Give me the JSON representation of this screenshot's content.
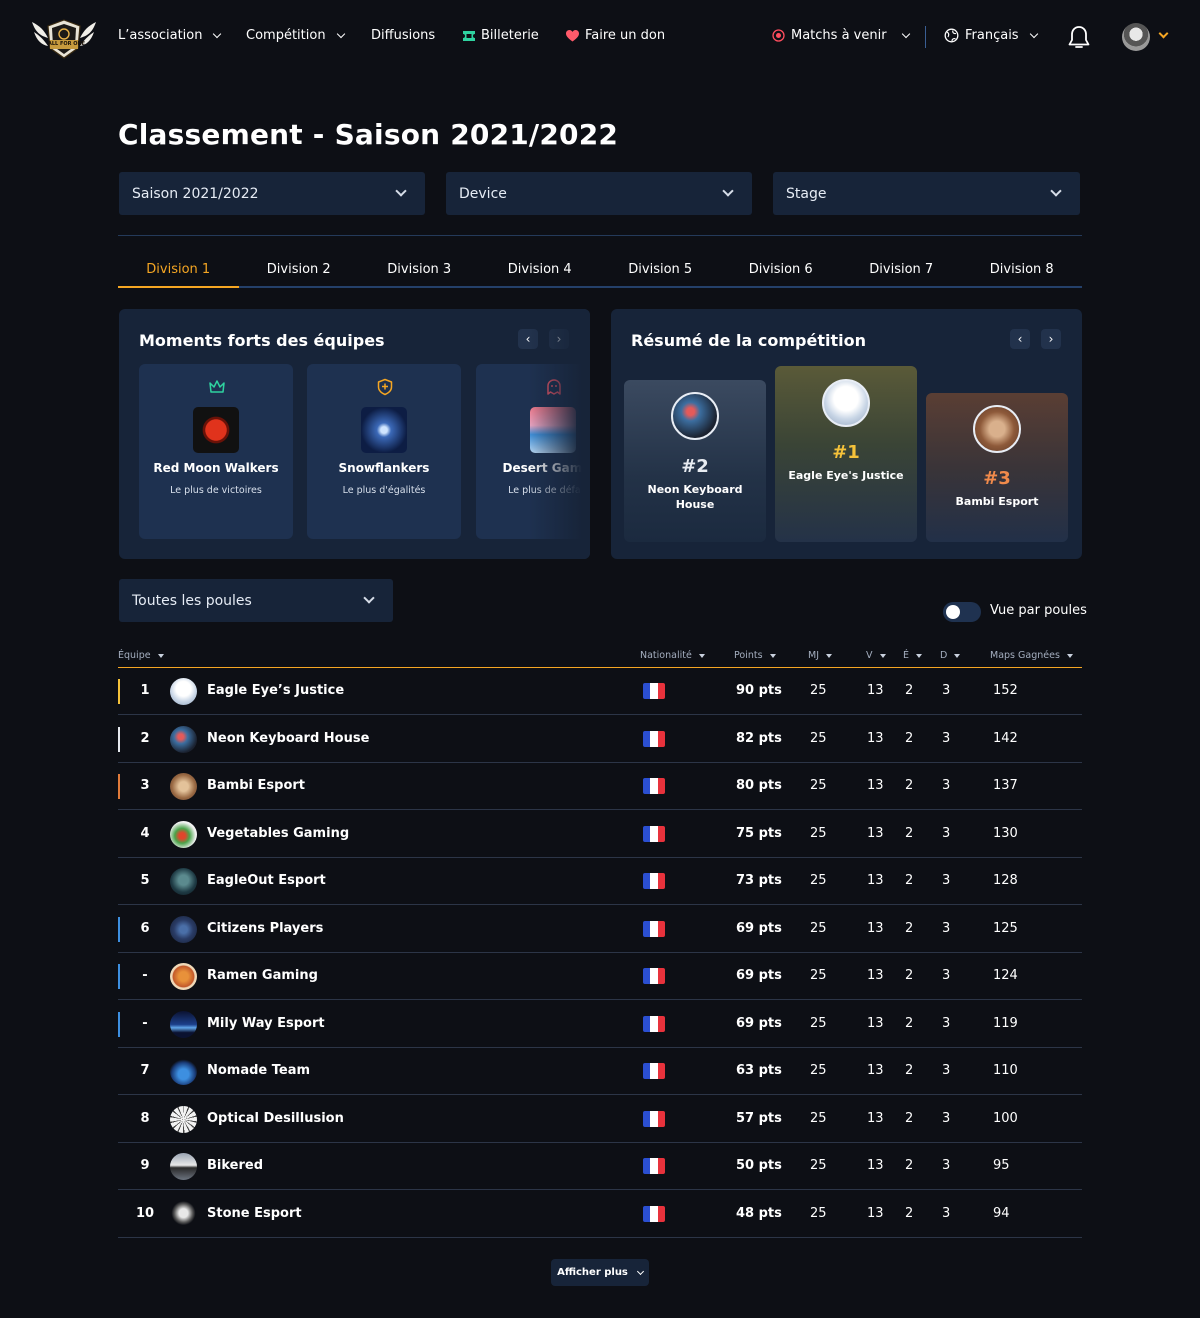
{
  "nav": {
    "logo_text": "ALL FOR ONE",
    "items": [
      "L’association",
      "Compétition",
      "Diffusions",
      "Billeterie",
      "Faire un don"
    ],
    "matches": "Matchs à venir",
    "language": "Français"
  },
  "page": {
    "title": "Classement - Saison 2021/2022"
  },
  "filters": {
    "season": "Saison 2021/2022",
    "device": "Device",
    "stage": "Stage",
    "pools": "Toutes les poules"
  },
  "tabs": [
    "Division 1",
    "Division 2",
    "Division 3",
    "Division 4",
    "Division 5",
    "Division 6",
    "Division 7",
    "Division 8"
  ],
  "highlights": {
    "title": "Moments forts des équipes",
    "cards": [
      {
        "name": "Red Moon Walkers",
        "sub": "Le plus de victoires",
        "icon": "crown-icon"
      },
      {
        "name": "Snowflankers",
        "sub": "Le plus d'égalités",
        "icon": "shield-plus-icon"
      },
      {
        "name": "Desert Gaming",
        "sub": "Le plus de défaites",
        "icon": "ghost-icon"
      }
    ]
  },
  "summary": {
    "title": "Résumé de la compétition",
    "podium": [
      {
        "rank": "#2",
        "name": "Neon Keyboard House"
      },
      {
        "rank": "#1",
        "name": "Eagle Eye's Justice"
      },
      {
        "rank": "#3",
        "name": "Bambi Esport"
      }
    ]
  },
  "toggle": {
    "label": "Vue par poules",
    "on": false
  },
  "table": {
    "headers": {
      "team": "Équipe",
      "nationality": "Nationalité",
      "points": "Points",
      "mj": "MJ",
      "v": "V",
      "e": "É",
      "d": "D",
      "maps": "Maps Gagnées"
    },
    "rows": [
      {
        "pos": "1",
        "team": "Eagle Eye’s Justice",
        "pts": "90 pts",
        "mj": "25",
        "v": "13",
        "e": "2",
        "d": "3",
        "maps": "152",
        "mark": "#f5c23a"
      },
      {
        "pos": "2",
        "team": "Neon Keyboard House",
        "pts": "82 pts",
        "mj": "25",
        "v": "13",
        "e": "2",
        "d": "3",
        "maps": "142",
        "mark": "#e6e9ef"
      },
      {
        "pos": "3",
        "team": "Bambi Esport",
        "pts": "80 pts",
        "mj": "25",
        "v": "13",
        "e": "2",
        "d": "3",
        "maps": "137",
        "mark": "#e07a3a"
      },
      {
        "pos": "4",
        "team": "Vegetables Gaming",
        "pts": "75 pts",
        "mj": "25",
        "v": "13",
        "e": "2",
        "d": "3",
        "maps": "130",
        "mark": ""
      },
      {
        "pos": "5",
        "team": "EagleOut Esport",
        "pts": "73 pts",
        "mj": "25",
        "v": "13",
        "e": "2",
        "d": "3",
        "maps": "128",
        "mark": ""
      },
      {
        "pos": "6",
        "team": "Citizens Players",
        "pts": "69 pts",
        "mj": "25",
        "v": "13",
        "e": "2",
        "d": "3",
        "maps": "125",
        "mark": "#3d8fe0"
      },
      {
        "pos": "-",
        "team": "Ramen Gaming",
        "pts": "69 pts",
        "mj": "25",
        "v": "13",
        "e": "2",
        "d": "3",
        "maps": "124",
        "mark": "#3d8fe0"
      },
      {
        "pos": "-",
        "team": "Mily Way Esport",
        "pts": "69 pts",
        "mj": "25",
        "v": "13",
        "e": "2",
        "d": "3",
        "maps": "119",
        "mark": "#3d8fe0"
      },
      {
        "pos": "7",
        "team": "Nomade Team",
        "pts": "63 pts",
        "mj": "25",
        "v": "13",
        "e": "2",
        "d": "3",
        "maps": "110",
        "mark": ""
      },
      {
        "pos": "8",
        "team": "Optical Desillusion",
        "pts": "57 pts",
        "mj": "25",
        "v": "13",
        "e": "2",
        "d": "3",
        "maps": "100",
        "mark": ""
      },
      {
        "pos": "9",
        "team": "Bikered",
        "pts": "50 pts",
        "mj": "25",
        "v": "13",
        "e": "2",
        "d": "3",
        "maps": "95",
        "mark": ""
      },
      {
        "pos": "10",
        "team": "Stone Esport",
        "pts": "48 pts",
        "mj": "25",
        "v": "13",
        "e": "2",
        "d": "3",
        "maps": "94",
        "mark": ""
      }
    ]
  },
  "more_button": "Afficher plus",
  "colors": {
    "accent": "#f5a623",
    "background": "#0d0f15",
    "panel": "#172439",
    "card": "#1e3150"
  }
}
